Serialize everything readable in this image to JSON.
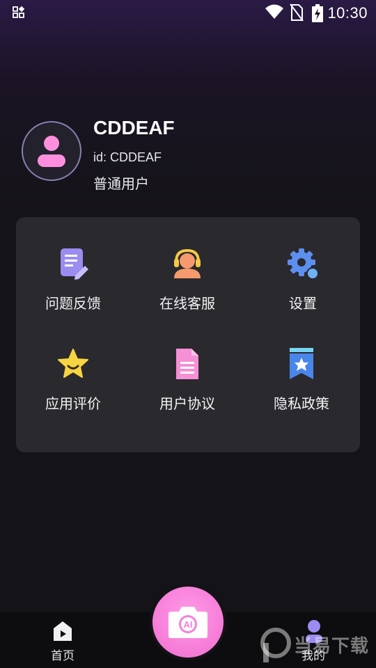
{
  "status_bar": {
    "time": "10:30"
  },
  "profile": {
    "name": "CDDEAF",
    "id_text": "id: CDDEAF",
    "user_type": "普通用户"
  },
  "menu": [
    {
      "label": "问题反馈",
      "icon": "feedback-icon"
    },
    {
      "label": "在线客服",
      "icon": "customer-service-icon"
    },
    {
      "label": "设置",
      "icon": "settings-gear-icon"
    },
    {
      "label": "应用评价",
      "icon": "star-rating-icon"
    },
    {
      "label": "用户协议",
      "icon": "document-icon"
    },
    {
      "label": "隐私政策",
      "icon": "privacy-bookmark-icon"
    }
  ],
  "bottom_nav": {
    "home_label": "首页",
    "mine_label": "我的",
    "camera_badge": "AI"
  },
  "watermark": {
    "text": "当易下载"
  },
  "colors": {
    "accent_pink": "#f77fd9",
    "panel_bg": "#2a292e",
    "background": "#141317"
  }
}
